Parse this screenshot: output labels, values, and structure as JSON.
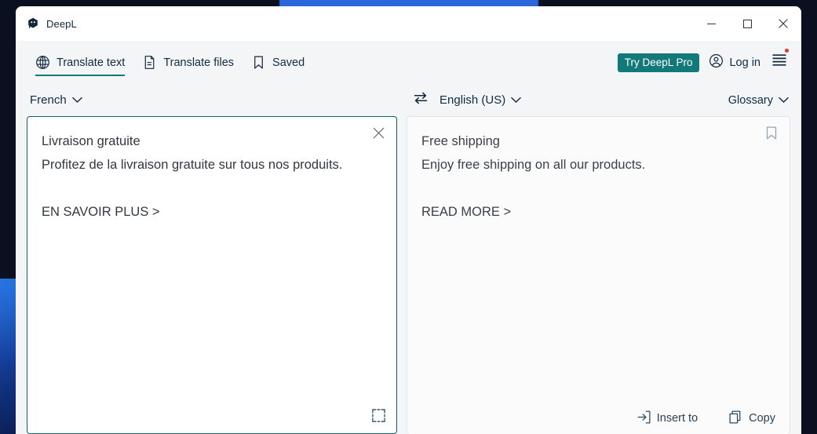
{
  "window": {
    "app_title": "DeepL",
    "logo_icon": "deepl-logo-icon",
    "controls": {
      "minimize_icon": "minimize-icon",
      "maximize_icon": "maximize-icon",
      "close_icon": "close-icon"
    }
  },
  "navbar": {
    "tabs": [
      {
        "label": "Translate text",
        "icon": "globe-icon",
        "active": true
      },
      {
        "label": "Translate files",
        "icon": "document-icon",
        "active": false
      },
      {
        "label": "Saved",
        "icon": "bookmark-icon",
        "active": false
      }
    ],
    "try_pro_label": "Try DeepL Pro",
    "login_label": "Log in",
    "login_icon": "account-circle-icon",
    "menu_icon": "hamburger-menu-icon",
    "accent_color": "#12797a",
    "badge_color": "#e3342f"
  },
  "langbar": {
    "source_language": "French",
    "target_language": "English (US)",
    "glossary_label": "Glossary",
    "swap_icon": "swap-arrows-icon",
    "chevron_icon": "chevron-down-icon"
  },
  "source_panel": {
    "text": "Livraison gratuite\nProfitez de la livraison gratuite sur tous nos produits.\n\nEN SAVOIR PLUS >",
    "clear_icon": "close-icon",
    "select_tool_icon": "select-region-icon",
    "border_color": "#11616b"
  },
  "target_panel": {
    "text": "Free shipping\nEnjoy free shipping on all our products.\n\nREAD MORE >",
    "bookmark_icon": "bookmark-outline-icon",
    "insert_label": "Insert to",
    "insert_icon": "insert-arrow-icon",
    "copy_label": "Copy",
    "copy_icon": "copy-icon"
  }
}
